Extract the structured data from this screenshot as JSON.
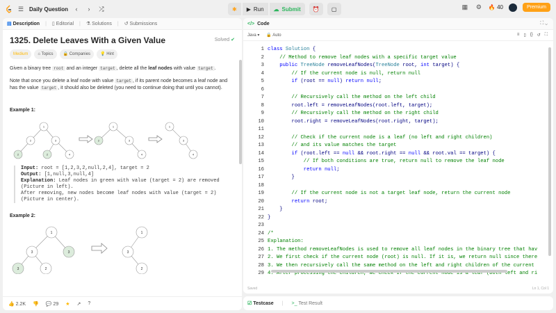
{
  "topbar": {
    "daily_question": "Daily Question",
    "run": "Run",
    "submit": "Submit",
    "streak": "40",
    "premium": "Premium"
  },
  "tabs": {
    "description": "Description",
    "editorial": "Editorial",
    "solutions": "Solutions",
    "submissions": "Submissions"
  },
  "problem": {
    "title": "1325. Delete Leaves With a Given Value",
    "status": "Solved",
    "difficulty": "Medium",
    "topics": "Topics",
    "companies": "Companies",
    "hint": "Hint",
    "p1_a": "Given a binary tree ",
    "p1_code1": "root",
    "p1_b": " and an integer ",
    "p1_code2": "target",
    "p1_c": ", delete all the ",
    "p1_bold": "leaf nodes",
    "p1_d": " with value ",
    "p1_code3": "target",
    "p1_e": ".",
    "p2_a": "Note that once you delete a leaf node with value ",
    "p2_code1": "target",
    "p2_b": ", if its parent node becomes a leaf node and has the value ",
    "p2_code2": "target",
    "p2_c": ", it should also be deleted (you need to continue doing that until you cannot).",
    "example1": "Example 1:",
    "ex1_input_label": "Input:",
    "ex1_input": " root = [1,2,3,2,null,2,4], target = 2",
    "ex1_output_label": "Output:",
    "ex1_output": " [1,null,3,null,4]",
    "ex1_expl_label": "Explanation:",
    "ex1_expl1": " Leaf nodes in green with value (target = 2) are removed",
    "ex1_expl2": "(Picture in left).",
    "ex1_expl3": "After removing, new nodes become leaf nodes with value (target = 2)",
    "ex1_expl4": "(Picture in center).",
    "example2": "Example 2:"
  },
  "trees": {
    "n1": "1",
    "n2": "2",
    "n3": "3",
    "n4": "4"
  },
  "footer": {
    "likes": "2.2K",
    "comments": "29"
  },
  "editor": {
    "tab": "Code",
    "language": "Java",
    "auto": "Auto",
    "saved": "Saved",
    "position": "Ln 1, Col 1"
  },
  "bottom": {
    "testcase": "Testcase",
    "test_result": "Test Result"
  },
  "colors": {
    "green_node": "#dcecdc",
    "accent": "#ffa116",
    "success": "#2db55d"
  }
}
